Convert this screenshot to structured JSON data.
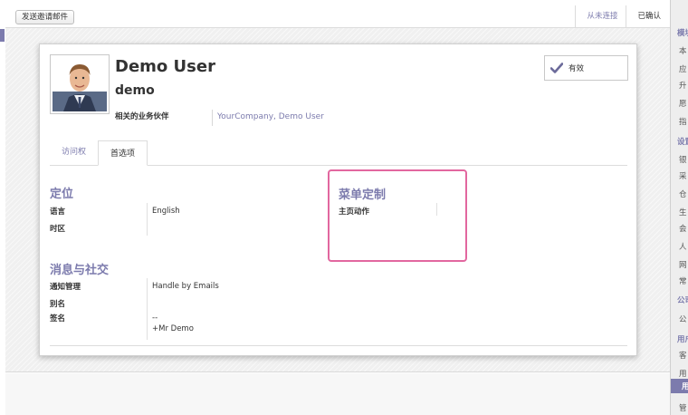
{
  "toolbar": {
    "invite_button": "发送邀请邮件",
    "status_steps": [
      "从未连接",
      "已确认"
    ]
  },
  "user": {
    "name": "Demo User",
    "login": "demo",
    "partner_label": "相关的业务伙伴",
    "partner_value": "YourCompany, Demo User",
    "active_label": "有效"
  },
  "tabs": [
    {
      "label": "访问权"
    },
    {
      "label": "首选项"
    }
  ],
  "sections": {
    "localization": {
      "title": "定位",
      "fields": [
        {
          "label": "语言",
          "value": "English"
        },
        {
          "label": "时区",
          "value": ""
        }
      ]
    },
    "menu": {
      "title": "菜单定制",
      "fields": [
        {
          "label": "主页动作",
          "value": ""
        }
      ]
    },
    "messaging": {
      "title": "消息与社交",
      "fields": [
        {
          "label": "通知管理",
          "value": "Handle by Emails"
        },
        {
          "label": "别名",
          "value": ""
        },
        {
          "label": "签名",
          "value": "--"
        },
        {
          "label": "",
          "value": "+Mr Demo"
        }
      ]
    }
  },
  "sidebar": {
    "items": [
      {
        "label": "模块",
        "head": true
      },
      {
        "label": "本"
      },
      {
        "label": "应"
      },
      {
        "label": "升"
      },
      {
        "label": "愿"
      },
      {
        "label": "指"
      },
      {
        "label": "设置",
        "head": true
      },
      {
        "label": "银"
      },
      {
        "label": "采"
      },
      {
        "label": "仓"
      },
      {
        "label": "生"
      },
      {
        "label": "会"
      },
      {
        "label": "人"
      },
      {
        "label": "网"
      },
      {
        "label": "常"
      },
      {
        "label": "公司",
        "head": true
      },
      {
        "label": "公"
      },
      {
        "label": "用户",
        "head": true
      },
      {
        "label": "客"
      },
      {
        "label": "用"
      },
      {
        "label": "用"
      },
      {
        "label": "管"
      }
    ]
  },
  "colors": {
    "accent": "#7c7bad",
    "highlight": "#e2679f"
  },
  "icons": {
    "active": "check-icon"
  }
}
